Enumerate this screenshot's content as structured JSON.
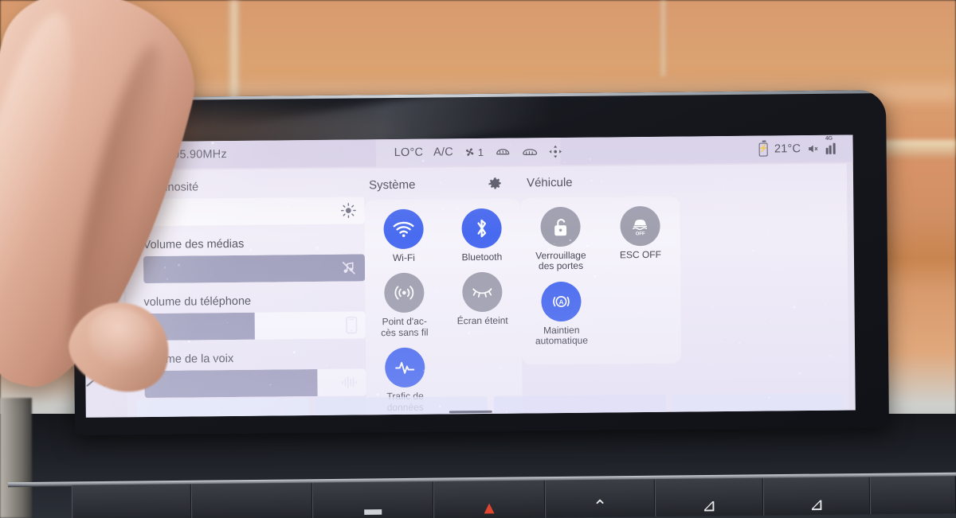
{
  "statusbar": {
    "media_source": "RFM - 95.90MHz",
    "play_icon": "play-triangle-icon",
    "climate_temp": "LO°C",
    "climate_ac": "A/C",
    "fan_icon": "fan-icon",
    "fan_speed": "1",
    "front_defrost_icon": "front-defrost-icon",
    "rear_defrost_icon": "rear-defrost-icon",
    "airflow_icon": "airflow-icon",
    "battery_icon": "battery-charging-icon",
    "outside_temp": "21°C",
    "mute_icon": "speaker-mute-icon",
    "network_label": "4G",
    "signal_icon": "signal-bars-icon"
  },
  "sidebar": {
    "items": [
      {
        "name": "sidebar-item-top",
        "icon": "dot-icon",
        "label": ""
      },
      {
        "name": "sidebar-item-phone",
        "icon": "phone-icon",
        "label": ""
      },
      {
        "name": "sidebar-item-vehicle",
        "icon": "car-icon",
        "label": ""
      }
    ]
  },
  "sliders": [
    {
      "name": "brightness",
      "label": "Luminosité",
      "fill_percent": 0,
      "icon": "sun-icon",
      "value": 0
    },
    {
      "name": "media-volume",
      "label": "Volume des médias",
      "fill_percent": 100,
      "icon": "music-note-muted-icon",
      "value": 100
    },
    {
      "name": "phone-volume",
      "label": "volume du téléphone",
      "fill_percent": 50,
      "icon": "smartphone-icon",
      "value": 50
    },
    {
      "name": "voice-volume",
      "label": "volume de la voix",
      "fill_percent": 78,
      "icon": "voice-wave-icon",
      "value": 78
    }
  ],
  "system": {
    "title": "Système",
    "settings_icon": "gear-icon",
    "tiles": [
      {
        "name": "wifi",
        "label": "Wi-Fi",
        "icon": "wifi-icon",
        "state": "on"
      },
      {
        "name": "bluetooth",
        "label": "Bluetooth",
        "icon": "bluetooth-icon",
        "state": "on"
      },
      {
        "name": "hotspot",
        "label": "Point d'ac-\ncès sans fil",
        "icon": "hotspot-icon",
        "state": "off"
      },
      {
        "name": "screen-off",
        "label": "Écran éteint",
        "icon": "closed-eye-icon",
        "state": "off"
      },
      {
        "name": "data-traffic",
        "label": "Trafic de\ndonnées",
        "icon": "data-pulse-icon",
        "state": "on"
      }
    ]
  },
  "vehicle": {
    "title": "Véhicule",
    "tiles": [
      {
        "name": "door-lock",
        "label": "Verrouillage\ndes portes",
        "icon": "unlocked-padlock-icon",
        "state": "off"
      },
      {
        "name": "esc-off",
        "label": "ESC OFF",
        "icon": "esc-off-car-icon",
        "state": "off"
      },
      {
        "name": "auto-hold",
        "label": "Maintien\nautomatique",
        "icon": "auto-hold-a-icon",
        "state": "on"
      }
    ]
  },
  "bottom": {
    "expand_icon": "chevron-up-icon",
    "segments": [
      "",
      "",
      "",
      ""
    ],
    "home_indicator": "home-indicator"
  },
  "dashboard_buttons": [
    {
      "name": "dash-button-1",
      "glyph": "",
      "color": "#cfd3d8"
    },
    {
      "name": "dash-button-2",
      "glyph": "",
      "color": "#cfd3d8"
    },
    {
      "name": "dash-button-3",
      "glyph": "▬",
      "color": "#cfd3d8"
    },
    {
      "name": "hazard-button",
      "glyph": "▲",
      "color": "#e0452f"
    },
    {
      "name": "dash-button-5",
      "glyph": "⌃",
      "color": "#e8eaec"
    },
    {
      "name": "rear-defrost-button",
      "glyph": "⊿",
      "color": "#e8eaec"
    },
    {
      "name": "front-defrost-button",
      "glyph": "⊿",
      "color": "#e8eaec"
    },
    {
      "name": "dash-button-8",
      "glyph": "",
      "color": "#cfd3d8"
    }
  ],
  "colors": {
    "accent_on": "#3f63ef",
    "tile_off": "#9c9cab",
    "slider_fill": "#9a9ab8",
    "screen_bg": "#e7e2f0",
    "text": "#3b3b47"
  }
}
